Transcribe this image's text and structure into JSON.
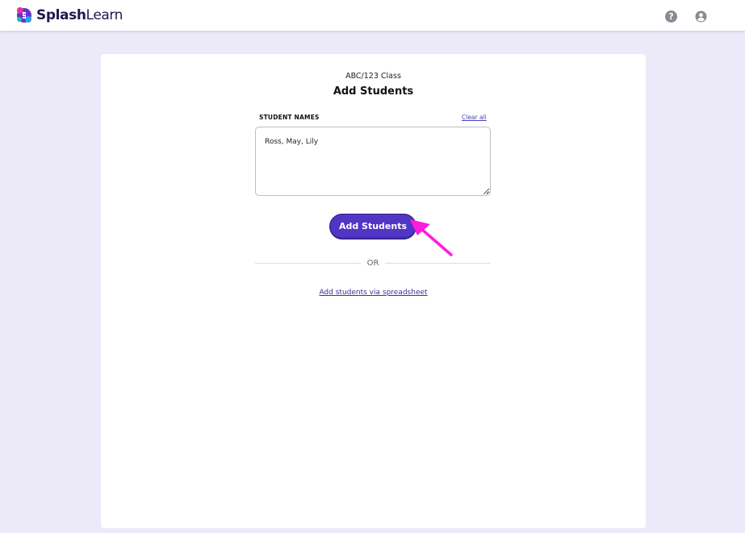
{
  "header": {
    "logo_text_bold": "Splash",
    "logo_text_regular": "Learn",
    "help_icon": "help-circle-icon",
    "user_icon": "user-account-icon"
  },
  "main": {
    "class_name": "ABC/123 Class",
    "title": "Add Students",
    "field_label": "STUDENT NAMES",
    "clear_all": "Clear all",
    "names_value": "Ross, May, Lily",
    "add_button": "Add Students",
    "divider_text": "OR",
    "spreadsheet_link": "Add students via spreadsheet"
  },
  "colors": {
    "primary": "#5136c5",
    "link": "#4a3fc4",
    "background": "#eceaf8",
    "annotation": "#ff1cdc"
  }
}
